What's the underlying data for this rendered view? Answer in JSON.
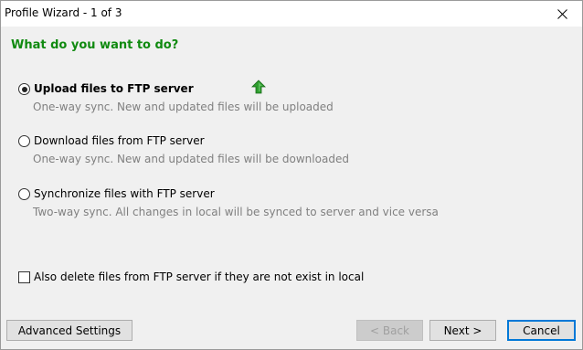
{
  "window": {
    "title": "Profile Wizard - 1 of 3"
  },
  "heading": "What do you want to do?",
  "options": [
    {
      "label": "Upload files to FTP server",
      "description": "One-way sync. New and updated files will be uploaded",
      "selected": true,
      "icon": "green-up-arrow-icon"
    },
    {
      "label": "Download files from FTP server",
      "description": "One-way sync. New and updated files will be downloaded",
      "selected": false
    },
    {
      "label": "Synchronize files with FTP server",
      "description": "Two-way sync. All changes in local will be synced to server and vice versa",
      "selected": false
    }
  ],
  "delete_option": {
    "label": "Also delete files from FTP server if they are not exist in local",
    "checked": false
  },
  "buttons": {
    "advanced": "Advanced Settings",
    "back": "< Back",
    "next": "Next >",
    "cancel": "Cancel"
  },
  "colors": {
    "heading": "#108a10",
    "description": "#808080",
    "window_bg": "#f0f0f0",
    "default_button_border": "#0078d7"
  }
}
